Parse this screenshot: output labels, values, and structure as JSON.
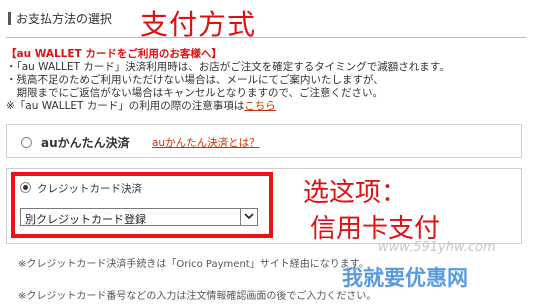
{
  "section": {
    "title": "お支払方法の選択"
  },
  "annotations": {
    "title": "支付方式",
    "choose": "选这项：",
    "credit_card": "信用卡支付"
  },
  "notice": {
    "heading": "【au WALLET カードをご利用のお客様へ】",
    "line1": "・「au WALLET カード」決済利用時は、お店がご注文を確定するタイミングで減額されます。",
    "line2": "・残高不足のためご利用いただけない場合は、メールにてご案内いたしますが、",
    "line3": "　期限までにご返信がない場合はキャンセルとなりますので、ご注意ください。",
    "line4_prefix": "※「au WALLET カード」の利用の際の注意事項は",
    "line4_link": "こちら"
  },
  "payment_options": {
    "au": {
      "label": "auかんたん決済",
      "help_link": "auかんたん決済とは？",
      "selected": false
    },
    "credit_card": {
      "label": "クレジットカード決済",
      "selected": true,
      "select_value": "別クレジットカード登録"
    }
  },
  "notes": {
    "note1": "※クレジットカード決済手続きは「Orico Payment」サイト経由になります。",
    "note2": "※クレジットカード番号などの入力は注文情報確認画面の後でご入力ください。"
  },
  "watermark": {
    "url": "www.591yhw.com",
    "logo": "我就要优惠网"
  },
  "colors": {
    "annotation_red": "#e01010",
    "link": "#cc3300",
    "highlight_border": "#ee1111",
    "watermark_blue": "#5a9be0"
  }
}
